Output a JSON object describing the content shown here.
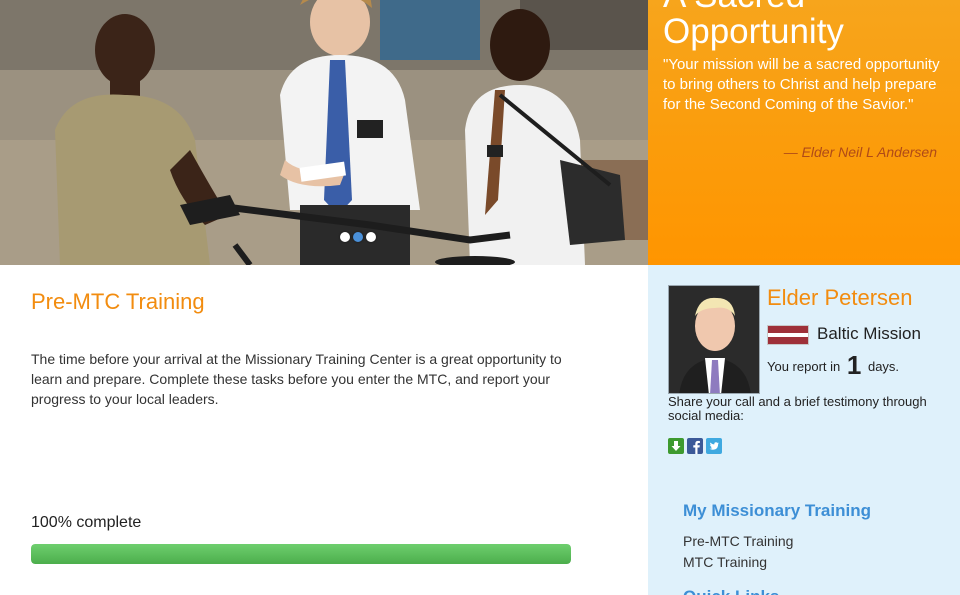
{
  "hero": {
    "title": "A Sacred Opportunity",
    "quote": "\"Your mission will be a sacred opportunity to bring others to Christ and help prepare for the Second Coming of the Savior.\"",
    "attribution": "— Elder Neil L Andersen",
    "carousel": {
      "slide_count": 3,
      "active_index": 1
    }
  },
  "main": {
    "heading": "Pre-MTC Training",
    "intro": "The time before your arrival at the Missionary Training Center is a great opportunity to learn and prepare. Complete these tasks before you enter the MTC, and report your progress to your local leaders.",
    "progress": {
      "label": "100% complete",
      "percent": 100
    }
  },
  "sidebar": {
    "profile": {
      "name": "Elder Petersen",
      "mission": "Baltic Mission",
      "report_prefix": "You report in",
      "report_days": "1",
      "report_suffix": "days."
    },
    "share": {
      "text": "Share your call and a brief testimony through social media:",
      "icons": [
        "download-icon",
        "facebook-icon",
        "twitter-icon"
      ]
    },
    "training": {
      "title": "My Missionary Training",
      "items": [
        {
          "label": "Pre-MTC Training"
        },
        {
          "label": "MTC Training"
        }
      ]
    },
    "quick_links": {
      "title": "Quick Links"
    }
  },
  "colors": {
    "accent_orange": "#f28c0f",
    "link_blue": "#3d8fd6",
    "sidebar_bg": "#dff1fb",
    "progress_green": "#4cae4c"
  }
}
